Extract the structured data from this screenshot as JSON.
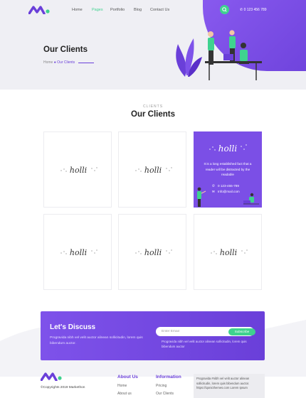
{
  "header": {
    "nav": [
      {
        "label": "Home"
      },
      {
        "label": "Pages"
      },
      {
        "label": "Portfolio"
      },
      {
        "label": "Blog"
      },
      {
        "label": "Contact Us"
      }
    ],
    "active_nav": "Pages",
    "phone": "0 123 456 789",
    "icons": {
      "search": "search-icon",
      "phone": "phone-icon"
    }
  },
  "hero": {
    "title": "Our Clients",
    "breadcrumb": {
      "home": "Home",
      "current": "Our Clients"
    }
  },
  "section": {
    "kicker": "CLIENTS",
    "title": "Our Clients"
  },
  "clients": {
    "logo_text": "holli",
    "featured": {
      "text": "It is a long established fact that a reader will be distracted by the readable",
      "phone": "0 123-455-789",
      "email": "Info@mail.com"
    }
  },
  "cta": {
    "title": "Let's Discuss",
    "text": "Progravida nibh vel velit auctor alinean sollicitudin, lorem quis bibendum auctor.",
    "input_placeholder": "Enter Email",
    "button": "Subscribe",
    "subtext": "Progravida nibh vel velit auctor alinean sollicitudin, lorem quis bibendum auctor"
  },
  "footer": {
    "copyright": "©Copyrights 2019 Markethon",
    "about_title": "About Us",
    "about_links": [
      "Home",
      "About us"
    ],
    "info_title": "Information",
    "info_links": [
      "Pricing",
      "Our Clients"
    ],
    "box_text": "Progravida #nibh vel velit auctor alinean sollicitudin, lorem quis bibendum auctor. https://iqonicthemes.com Lorem Ipsum"
  },
  "colors": {
    "primary": "#6a3fd9",
    "accent": "#3fd28f",
    "hero_bg": "#efeff4"
  }
}
